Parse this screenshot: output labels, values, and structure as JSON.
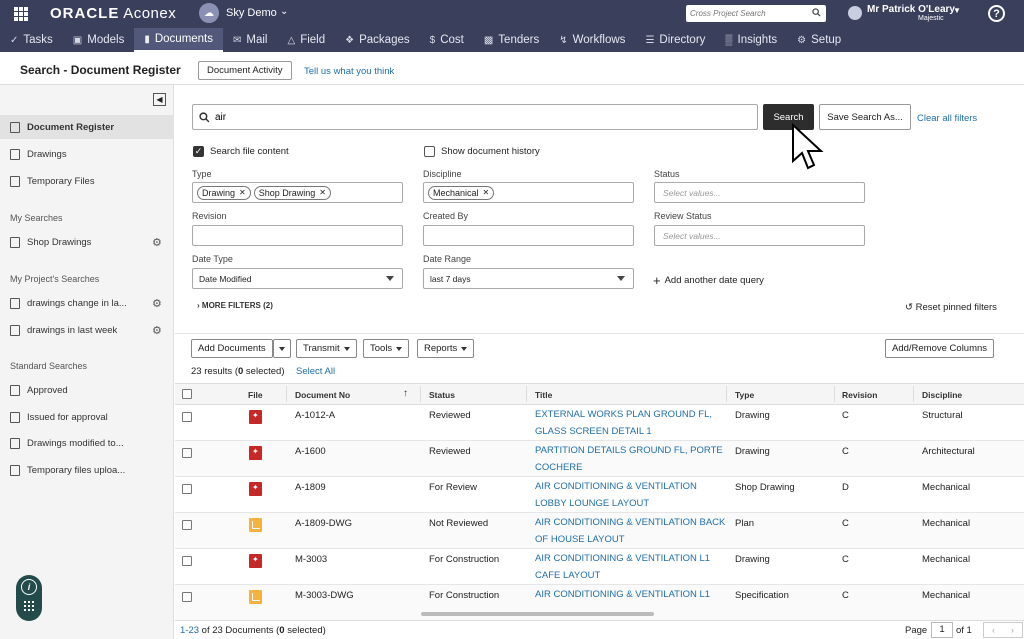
{
  "topbar": {
    "brand_oracle": "ORACLE",
    "brand_aconex": "Aconex",
    "project_name": "Sky Demo",
    "cross_search_placeholder": "Cross Project Search",
    "user_name": "Mr Patrick O'Leary",
    "user_org": "Majestic",
    "help_label": "?"
  },
  "nav": {
    "tabs": [
      {
        "label": "Tasks",
        "icon": "check-icon"
      },
      {
        "label": "Models",
        "icon": "cube-icon"
      },
      {
        "label": "Documents",
        "icon": "document-icon",
        "active": true
      },
      {
        "label": "Mail",
        "icon": "mail-icon"
      },
      {
        "label": "Field",
        "icon": "field-icon"
      },
      {
        "label": "Packages",
        "icon": "packages-icon"
      },
      {
        "label": "Cost",
        "icon": "cost-icon"
      },
      {
        "label": "Tenders",
        "icon": "tenders-icon"
      },
      {
        "label": "Workflows",
        "icon": "workflows-icon"
      },
      {
        "label": "Directory",
        "icon": "directory-icon"
      },
      {
        "label": "Insights",
        "icon": "insights-icon"
      },
      {
        "label": "Setup",
        "icon": "gear-icon"
      }
    ]
  },
  "header": {
    "title": "Search - Document Register",
    "activity_button": "Document Activity",
    "feedback_link": "Tell us what you think"
  },
  "sidebar": {
    "items": [
      {
        "label": "Document Register",
        "active": true
      },
      {
        "label": "Drawings"
      },
      {
        "label": "Temporary Files"
      }
    ],
    "my_searches_heading": "My Searches",
    "my_searches": [
      {
        "label": "Shop Drawings"
      }
    ],
    "project_searches_heading": "My Project's Searches",
    "project_searches": [
      {
        "label": "drawings change in la..."
      },
      {
        "label": "drawings in last week"
      }
    ],
    "standard_heading": "Standard Searches",
    "standard_searches": [
      {
        "label": "Approved"
      },
      {
        "label": "Issued for approval"
      },
      {
        "label": "Drawings modified to..."
      },
      {
        "label": "Temporary files uploa..."
      }
    ]
  },
  "search": {
    "query": "air",
    "search_button": "Search",
    "save_button": "Save Search As...",
    "clear_link": "Clear all filters",
    "search_file_content": "Search file content",
    "show_history": "Show document history"
  },
  "filters": {
    "type_label": "Type",
    "type_chips": [
      "Drawing",
      "Shop Drawing"
    ],
    "discipline_label": "Discipline",
    "discipline_chips": [
      "Mechanical"
    ],
    "status_label": "Status",
    "status_placeholder": "Select values...",
    "revision_label": "Revision",
    "created_by_label": "Created By",
    "review_status_label": "Review Status",
    "review_status_placeholder": "Select values...",
    "date_type_label": "Date Type",
    "date_type_value": "Date Modified",
    "date_range_label": "Date Range",
    "date_range_value": "last 7 days",
    "add_date_query": "Add another date query",
    "more_filters": "MORE FILTERS (2)",
    "reset_pinned": "Reset pinned filters"
  },
  "toolbar": {
    "add_documents": "Add Documents",
    "transmit": "Transmit",
    "tools": "Tools",
    "reports": "Reports",
    "add_remove_columns": "Add/Remove Columns"
  },
  "results": {
    "count_prefix": "23 results (",
    "selected_count": "0",
    "count_suffix": " selected)",
    "select_all": "Select All"
  },
  "table": {
    "headers": {
      "file": "File",
      "doc_no": "Document No",
      "status": "Status",
      "title": "Title",
      "type": "Type",
      "revision": "Revision",
      "discipline": "Discipline"
    },
    "rows": [
      {
        "file": "pdf",
        "doc_no": "A-1012-A",
        "status": "Reviewed",
        "title": "EXTERNAL WORKS PLAN GROUND FL, GLASS SCREEN DETAIL 1",
        "type": "Drawing",
        "revision": "C",
        "discipline": "Structural"
      },
      {
        "file": "pdf",
        "doc_no": "A-1600",
        "status": "Reviewed",
        "title": "PARTITION DETAILS GROUND FL, PORTE COCHERE",
        "type": "Drawing",
        "revision": "C",
        "discipline": "Architectural"
      },
      {
        "file": "pdf",
        "doc_no": "A-1809",
        "status": "For Review",
        "title": "AIR CONDITIONING & VENTILATION LOBBY LOUNGE LAYOUT",
        "type": "Shop Drawing",
        "revision": "D",
        "discipline": "Mechanical"
      },
      {
        "file": "dwg",
        "doc_no": "A-1809-DWG",
        "status": "Not Reviewed",
        "title": "AIR CONDITIONING & VENTILATION BACK OF HOUSE LAYOUT",
        "type": "Plan",
        "revision": "C",
        "discipline": "Mechanical"
      },
      {
        "file": "pdf",
        "doc_no": "M-3003",
        "status": "For Construction",
        "title": "AIR CONDITIONING & VENTILATION L1 CAFE LAYOUT",
        "type": "Drawing",
        "revision": "C",
        "discipline": "Mechanical"
      },
      {
        "file": "dwg",
        "doc_no": "M-3003-DWG",
        "status": "For Construction",
        "title": "AIR CONDITIONING & VENTILATION L1",
        "type": "Specification",
        "revision": "C",
        "discipline": "Mechanical"
      }
    ]
  },
  "footer": {
    "range": "1-23",
    "of_text": "of 23 Documents (",
    "selected": "0",
    "selected_suffix": " selected)",
    "page_label": "Page",
    "page_value": "1",
    "of_pages": "of 1"
  },
  "colors": {
    "topbar": "#3a3f5c",
    "link": "#1f6fa8",
    "pdf": "#c62828",
    "dwg": "#f3b33d"
  }
}
